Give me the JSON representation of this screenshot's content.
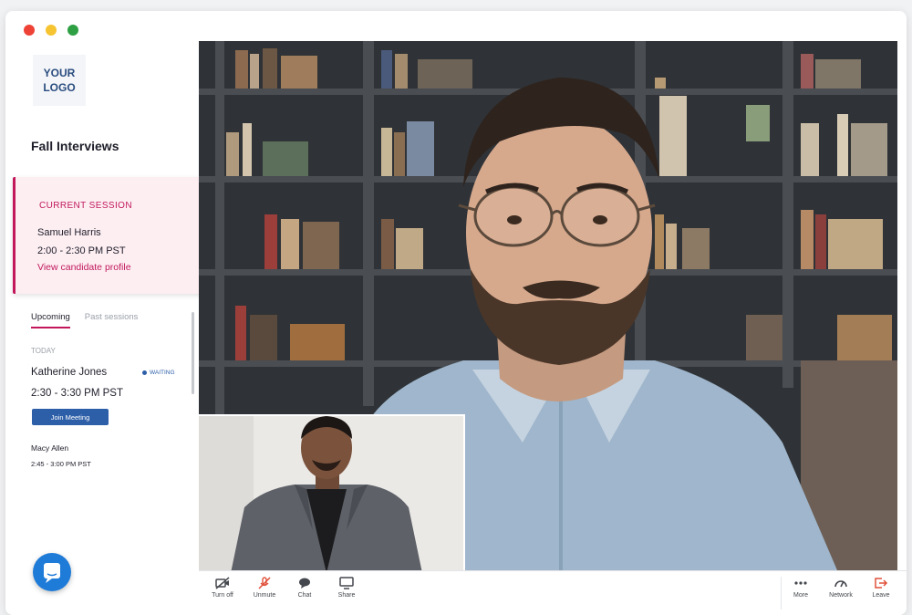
{
  "window": {
    "traffic_lights": [
      "#ee4237",
      "#f6c431",
      "#2ea043"
    ]
  },
  "logo": {
    "line1": "YOUR",
    "line2": "LOGO"
  },
  "sidebar": {
    "title": "Fall Interviews",
    "current_session": {
      "label": "CURRENT SESSION",
      "name": "Samuel Harris",
      "time": "2:00 - 2:30 PM PST",
      "link": "View candidate profile"
    },
    "tabs": [
      {
        "label": "Upcoming",
        "active": true
      },
      {
        "label": "Past sessions",
        "active": false
      }
    ],
    "day_label": "TODAY",
    "upcoming": [
      {
        "name": "Katherine Jones",
        "time": "2:30 - 3:30 PM PST",
        "status": "WAITING",
        "action": "Join Meeting"
      },
      {
        "name": "Macy Allen",
        "time": "2:45 - 3:00 PM PST"
      }
    ],
    "chat_icon": "chat-bubble-icon"
  },
  "colors": {
    "accent": "#c2185b",
    "primary_blue": "#2d5ea8",
    "chat_button": "#1f7bd8",
    "leave": "#e0503a"
  },
  "toolbar": {
    "left": [
      {
        "label": "Turn off",
        "icon": "video-off-icon"
      },
      {
        "label": "Unmute",
        "icon": "mic-off-icon"
      },
      {
        "label": "Chat",
        "icon": "chat-icon"
      },
      {
        "label": "Share",
        "icon": "screen-share-icon"
      }
    ],
    "right": [
      {
        "label": "More",
        "icon": "more-dots-icon"
      },
      {
        "label": "Network",
        "icon": "network-gauge-icon"
      },
      {
        "label": "Leave",
        "icon": "leave-icon"
      }
    ]
  }
}
